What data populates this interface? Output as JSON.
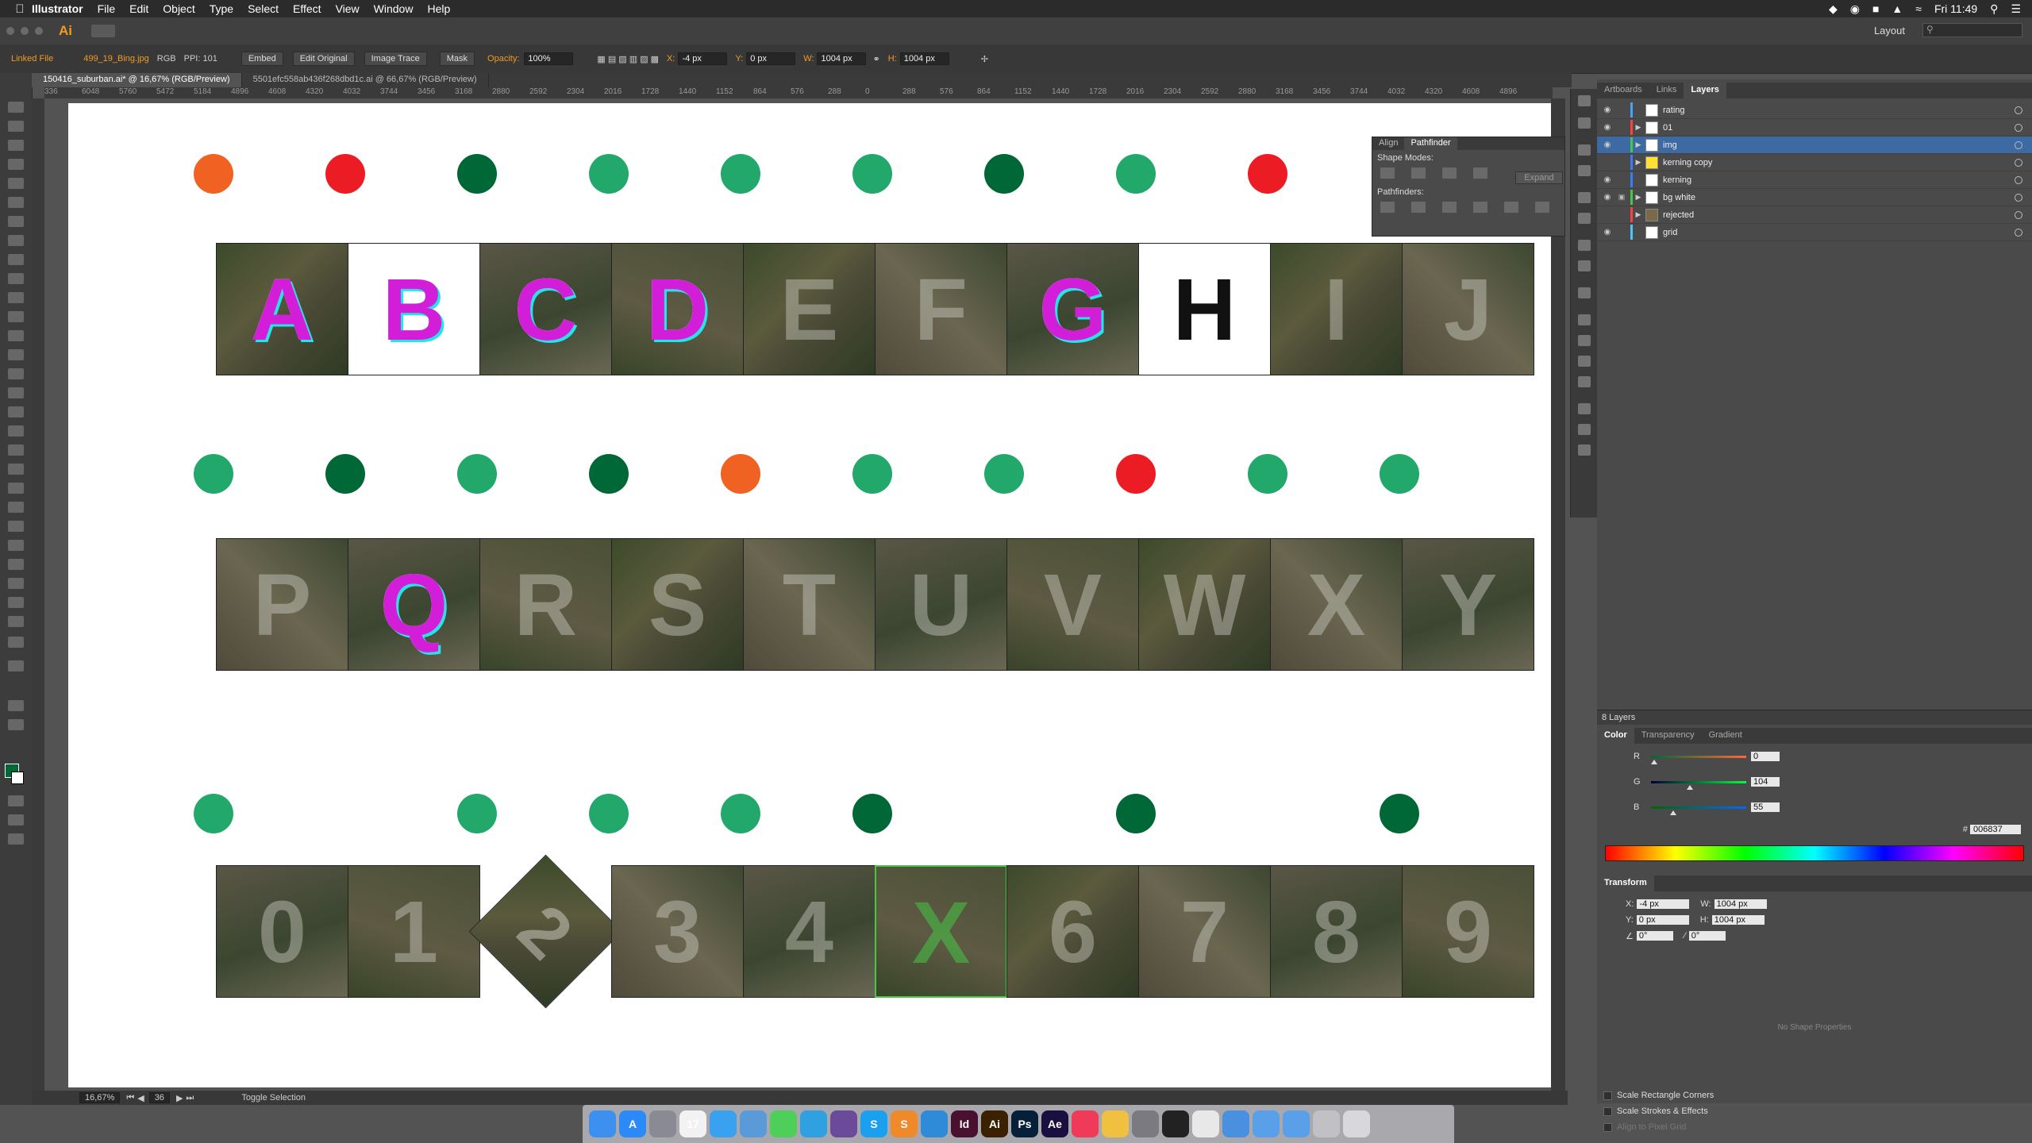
{
  "menubar": {
    "app": "Illustrator",
    "menus": [
      "File",
      "Edit",
      "Object",
      "Type",
      "Select",
      "Effect",
      "View",
      "Window",
      "Help"
    ],
    "clock": "Fri 11:49"
  },
  "appbar": {
    "workspace": "Layout",
    "logo": "Ai"
  },
  "controlbar": {
    "linked_file": "Linked File",
    "filename": "499_19_Bing.jpg",
    "color_mode": "RGB",
    "ppi": "PPI: 101",
    "embed": "Embed",
    "edit_original": "Edit Original",
    "image_trace": "Image Trace",
    "mask": "Mask",
    "opacity_label": "Opacity:",
    "opacity": "100%",
    "x_label": "X:",
    "x": "-4 px",
    "y_label": "Y:",
    "y": "0 px",
    "w_label": "W:",
    "w": "1004 px",
    "h_label": "H:",
    "h": "1004 px"
  },
  "tabs": [
    "150416_suburban.ai* @ 16,67% (RGB/Preview)",
    "5501efc558ab436f268dbd1c.ai @ 66,67% (RGB/Preview)"
  ],
  "ruler_ticks": [
    "336",
    "6048",
    "5760",
    "5472",
    "5184",
    "4896",
    "4608",
    "4320",
    "4032",
    "3744",
    "3456",
    "3168",
    "2880",
    "2592",
    "2304",
    "2016",
    "1728",
    "1440",
    "1152",
    "864",
    "576",
    "288",
    "0",
    "288",
    "576",
    "864",
    "1152",
    "1440",
    "1728",
    "2016",
    "2304",
    "2592",
    "2880",
    "3168",
    "3456",
    "3744",
    "4032",
    "4320",
    "4608",
    "4896"
  ],
  "colors": {
    "orange": "#ef6222",
    "red": "#ec1c24",
    "dark_green": "#006837",
    "green": "#21a86a"
  },
  "rows": [
    {
      "dots": [
        "orange",
        "red",
        "dark_green",
        "green",
        "green",
        "green",
        "dark_green",
        "green",
        "red"
      ],
      "tiles": [
        {
          "letter": "A",
          "style": "overlay"
        },
        {
          "letter": "B",
          "style": "mask"
        },
        {
          "letter": "C",
          "style": "overlay"
        },
        {
          "letter": "D",
          "style": "overlay"
        },
        {
          "letter": "E",
          "style": "aerial"
        },
        {
          "letter": "F",
          "style": "aerial"
        },
        {
          "letter": "G",
          "style": "overlay"
        },
        {
          "letter": "H",
          "style": "bw"
        },
        {
          "letter": "I",
          "style": "aerial"
        },
        {
          "letter": "J",
          "style": "aerial"
        }
      ]
    },
    {
      "dots": [
        "green",
        "dark_green",
        "green",
        "dark_green",
        "orange",
        "green",
        "green",
        "red",
        "green",
        "green"
      ],
      "tiles": [
        {
          "letter": "P",
          "style": "aerial"
        },
        {
          "letter": "Q",
          "style": "overlay"
        },
        {
          "letter": "R",
          "style": "aerial"
        },
        {
          "letter": "S",
          "style": "aerial"
        },
        {
          "letter": "T",
          "style": "aerial"
        },
        {
          "letter": "U",
          "style": "aerial"
        },
        {
          "letter": "V",
          "style": "aerial"
        },
        {
          "letter": "W",
          "style": "aerial"
        },
        {
          "letter": "X",
          "style": "aerial"
        },
        {
          "letter": "Y",
          "style": "aerial"
        }
      ]
    },
    {
      "dots": [
        "green",
        "",
        "green",
        "green",
        "green",
        "dark_green",
        "",
        "dark_green",
        "",
        "dark_green"
      ],
      "tiles": [
        {
          "letter": "0",
          "style": "aerial"
        },
        {
          "letter": "1",
          "style": "aerial"
        },
        {
          "letter": "2",
          "style": "rotated"
        },
        {
          "letter": "3",
          "style": "aerial"
        },
        {
          "letter": "4",
          "style": "aerial"
        },
        {
          "letter": "X",
          "style": "selected"
        },
        {
          "letter": "6",
          "style": "aerial"
        },
        {
          "letter": "7",
          "style": "aerial"
        },
        {
          "letter": "8",
          "style": "aerial"
        },
        {
          "letter": "9",
          "style": "aerial"
        }
      ]
    }
  ],
  "pathfinder": {
    "tabs": [
      "Align",
      "Pathfinder"
    ],
    "shape_modes": "Shape Modes:",
    "pathfinders": "Pathfinders:",
    "expand": "Expand"
  },
  "layers_panel": {
    "tabs": [
      "Artboards",
      "Links",
      "Layers"
    ],
    "layers": [
      {
        "name": "rating",
        "color": "#4aa0ff",
        "visible": true,
        "locked": false,
        "expand": false,
        "thumb": "#ffffff"
      },
      {
        "name": "01",
        "color": "#ff4040",
        "visible": true,
        "locked": false,
        "expand": true,
        "thumb": "#ffffff"
      },
      {
        "name": "img",
        "color": "#46c846",
        "visible": true,
        "locked": false,
        "expand": true,
        "thumb": "#ffffff",
        "selected": true
      },
      {
        "name": "kerning copy",
        "color": "#3a7aff",
        "visible": false,
        "locked": false,
        "expand": true,
        "thumb": "#ffe033"
      },
      {
        "name": "kerning",
        "color": "#3a7aff",
        "visible": true,
        "locked": false,
        "expand": false,
        "thumb": "#ffffff"
      },
      {
        "name": "bg white",
        "color": "#46c846",
        "visible": true,
        "locked": true,
        "expand": true,
        "thumb": "#ffffff"
      },
      {
        "name": "rejected",
        "color": "#ff4040",
        "visible": false,
        "locked": false,
        "expand": true,
        "thumb": "#7a6a4a"
      },
      {
        "name": "grid",
        "color": "#46c8ff",
        "visible": true,
        "locked": false,
        "expand": false,
        "thumb": "#ffffff"
      }
    ],
    "count": "8 Layers"
  },
  "color_panel": {
    "tabs": [
      "Color",
      "Transparency",
      "Gradient"
    ],
    "r_label": "R",
    "r": "0",
    "g_label": "G",
    "g": "104",
    "b_label": "B",
    "b": "55",
    "hex_label": "#",
    "hex": "006837"
  },
  "transform_panel": {
    "title": "Transform",
    "x_label": "X:",
    "x": "-4 px",
    "y_label": "Y:",
    "y": "0 px",
    "w_label": "W:",
    "w": "1004 px",
    "h_label": "H:",
    "h": "1004 px",
    "angle": "0°",
    "shear": "0°",
    "no_shape": "No Shape Properties",
    "scale_corners": "Scale Rectangle Corners",
    "scale_strokes": "Scale Strokes & Effects",
    "align_pixel": "Align to Pixel Grid"
  },
  "status": {
    "zoom": "16,67%",
    "artboard": "36",
    "action": "Toggle Selection"
  },
  "dock_apps": [
    {
      "name": "finder",
      "label": "",
      "bg": "#3d8ff0"
    },
    {
      "name": "app-store",
      "label": "A",
      "bg": "#2b8af7"
    },
    {
      "name": "launchpad",
      "label": "",
      "bg": "#8a8a95"
    },
    {
      "name": "calendar",
      "label": "17",
      "bg": "#f2f2f2"
    },
    {
      "name": "safari",
      "label": "",
      "bg": "#3aa0f0"
    },
    {
      "name": "preview",
      "label": "",
      "bg": "#5a9ad8"
    },
    {
      "name": "messages",
      "label": "",
      "bg": "#4dcf5a"
    },
    {
      "name": "skype-chat",
      "label": "",
      "bg": "#2fa0e0"
    },
    {
      "name": "github",
      "label": "",
      "bg": "#6b4a9a"
    },
    {
      "name": "skype",
      "label": "S",
      "bg": "#1aa0ef"
    },
    {
      "name": "sublime",
      "label": "S",
      "bg": "#ef8a2a"
    },
    {
      "name": "keynote",
      "label": "",
      "bg": "#2f8ad8"
    },
    {
      "name": "indesign",
      "label": "Id",
      "bg": "#4a1030"
    },
    {
      "name": "illustrator",
      "label": "Ai",
      "bg": "#3a2200"
    },
    {
      "name": "photoshop",
      "label": "Ps",
      "bg": "#06203a"
    },
    {
      "name": "after-effects",
      "label": "Ae",
      "bg": "#1a1040"
    },
    {
      "name": "itunes",
      "label": "",
      "bg": "#f03a5a"
    },
    {
      "name": "photos",
      "label": "",
      "bg": "#f0c040"
    },
    {
      "name": "system-prefs",
      "label": "",
      "bg": "#7a7a80"
    },
    {
      "name": "terminal",
      "label": "",
      "bg": "#222222"
    },
    {
      "name": "notes",
      "label": "",
      "bg": "#e8e8e8"
    },
    {
      "name": "folder-apps",
      "label": "",
      "bg": "#4a90e0"
    },
    {
      "name": "folder-docs",
      "label": "",
      "bg": "#5aa0e8"
    },
    {
      "name": "downloads",
      "label": "",
      "bg": "#5aa0e8"
    },
    {
      "name": "keyboard",
      "label": "",
      "bg": "#c0c0c5"
    },
    {
      "name": "trash",
      "label": "",
      "bg": "#d8d8dc"
    }
  ]
}
